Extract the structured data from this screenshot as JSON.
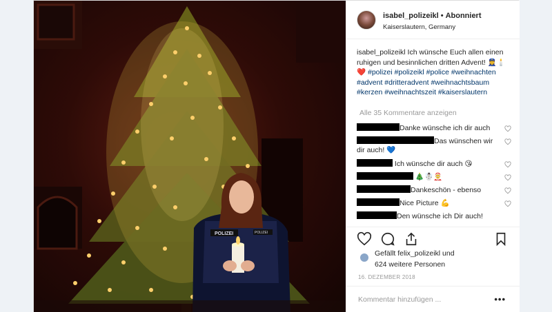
{
  "post": {
    "username": "isabel_polizeikl",
    "separator": "•",
    "follow_status": "Abonniert",
    "location": "Kaiserslautern, Germany",
    "caption_user": "isabel_polizeikl",
    "caption_text": " Ich wünsche Euch allen einen ruhigen und besinnlichen dritten Advent! 👮‍♀️🕯️❤️ ",
    "hashtags": [
      "#polizei",
      "#polizeikl",
      "#police",
      "#weihnachten",
      "#advent",
      "#dritteradvent",
      "#weihnachtsbaum",
      "#kerzen",
      "#weihnachtszeit",
      "#kaiserslautern"
    ],
    "view_all_comments": "Alle 35 Kommentare anzeigen",
    "comments": [
      {
        "text": "Danke wünsche ich dir auch"
      },
      {
        "text": "Das wünschen wir dir auch! 💙"
      },
      {
        "text": " Ich wünsche dir auch 😘"
      },
      {
        "text": " 🎄☃️🤶"
      },
      {
        "text": "Dankeschön - ebenso"
      },
      {
        "text": "Nice Picture 💪"
      },
      {
        "text": "Den wünsche ich Dir auch!"
      }
    ],
    "likes_line1": "Gefällt felix_polizeikl und",
    "likes_line2": "624 weitere Personen",
    "date": "16. DEZEMBER 2018",
    "comment_placeholder": "Kommentar hinzufügen ...",
    "more_label": "•••",
    "vest_label": "POLIZEI",
    "vest_label_small": "POLIZEI"
  },
  "colors": {
    "hashtag": "#003569",
    "text": "#262626",
    "muted": "#999999",
    "like_heart": "#ed4956"
  }
}
